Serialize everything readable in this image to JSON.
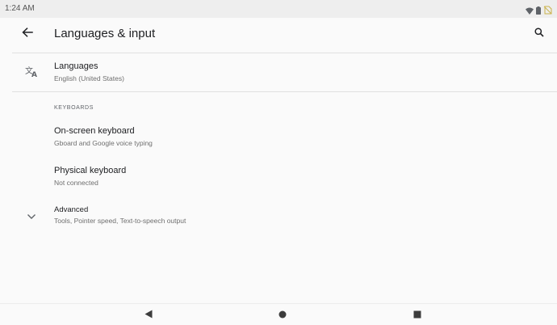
{
  "status_bar": {
    "time": "1:24 AM",
    "icons": [
      "wifi-icon",
      "battery-icon",
      "no-sim-icon"
    ]
  },
  "app_bar": {
    "title": "Languages & input",
    "back_icon": "arrow-back-icon",
    "search_icon": "search-icon"
  },
  "languages": {
    "title": "Languages",
    "summary": "English (United States)",
    "icon": "translate-icon"
  },
  "keyboards": {
    "header": "KEYBOARDS",
    "items": [
      {
        "title": "On-screen keyboard",
        "summary": "Gboard and Google voice typing"
      },
      {
        "title": "Physical keyboard",
        "summary": "Not connected"
      }
    ]
  },
  "advanced": {
    "title": "Advanced",
    "summary": "Tools, Pointer speed, Text-to-speech output",
    "icon": "chevron-down-icon"
  },
  "nav_bar": {
    "icons": [
      "back-triangle-icon",
      "home-circle-icon",
      "recents-square-icon"
    ]
  },
  "colors": {
    "background": "#fafafa",
    "status_bar": "#eeeeee",
    "text_primary": "#202124",
    "text_secondary": "#6f6f6f",
    "divider": "#e0e0e0"
  }
}
